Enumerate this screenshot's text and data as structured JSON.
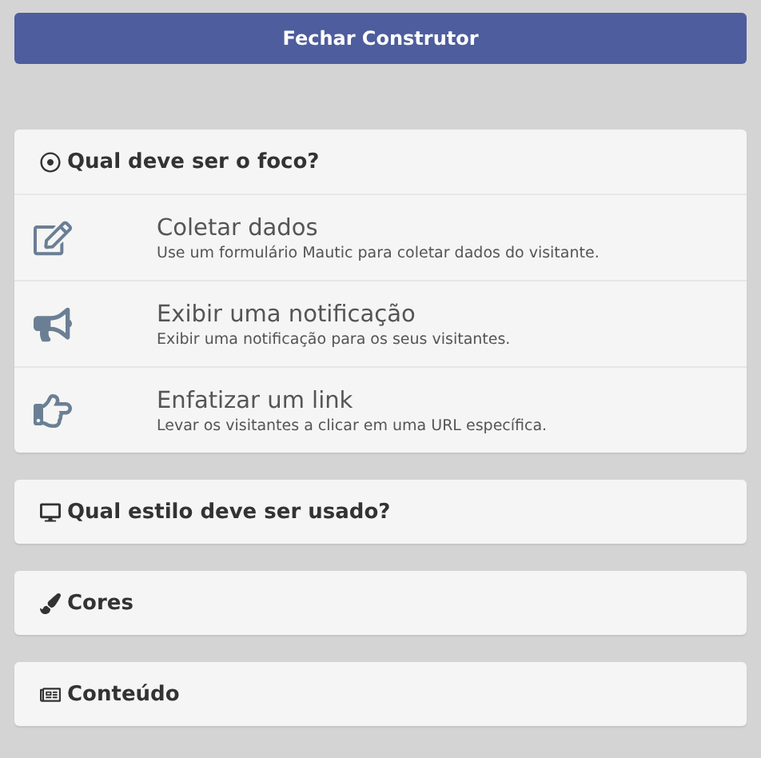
{
  "close_button": "Fechar Construtor",
  "panels": [
    {
      "title": "Qual deve ser o foco?",
      "expanded": true,
      "options": [
        {
          "title": "Coletar dados",
          "description": "Use um formulário Mautic para coletar dados do visitante."
        },
        {
          "title": "Exibir uma notificação",
          "description": "Exibir uma notificação para os seus visitantes."
        },
        {
          "title": "Enfatizar um link",
          "description": "Levar os visitantes a clicar em uma URL específica."
        }
      ]
    },
    {
      "title": "Qual estilo deve ser usado?",
      "expanded": false
    },
    {
      "title": "Cores",
      "expanded": false
    },
    {
      "title": "Conteúdo",
      "expanded": false
    }
  ]
}
